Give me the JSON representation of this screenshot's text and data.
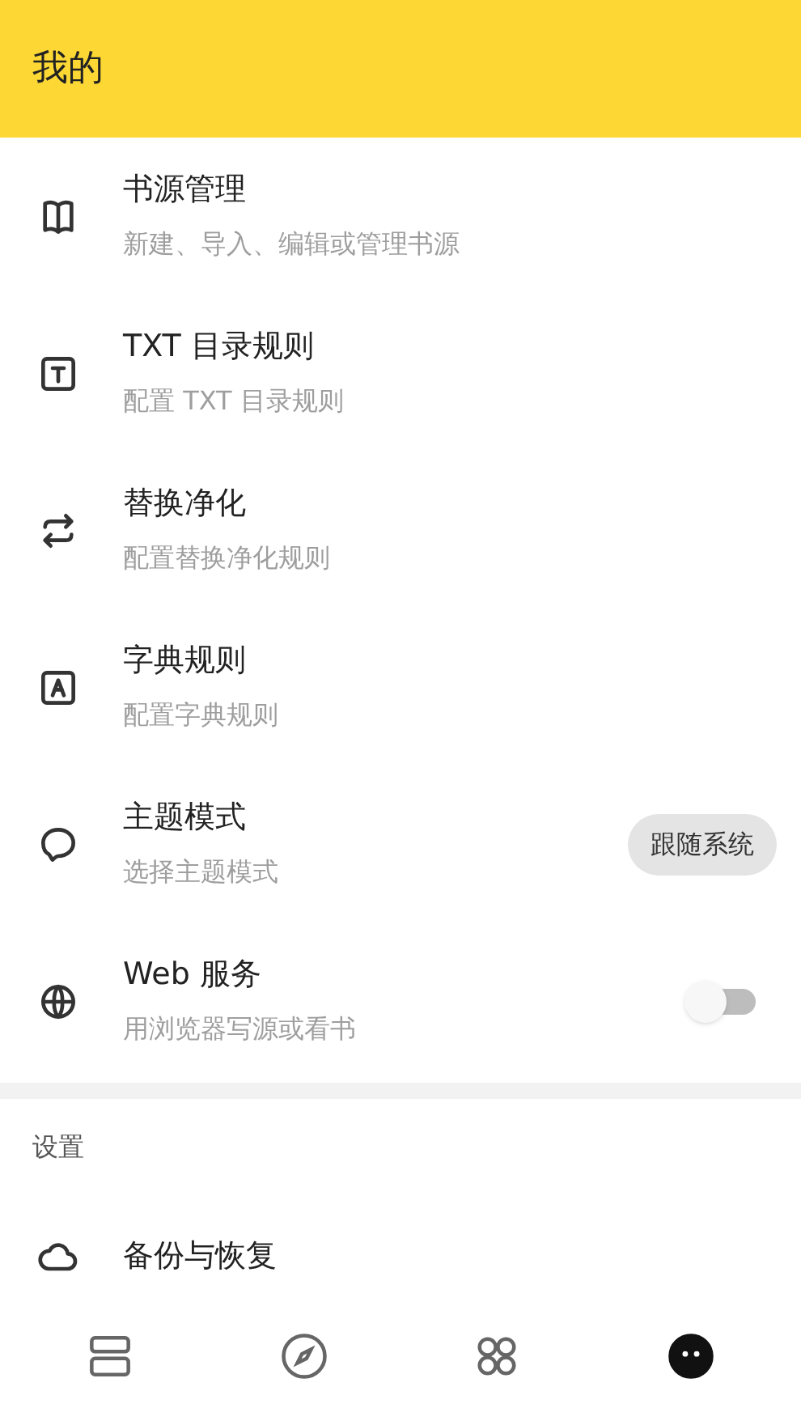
{
  "app_bar": {
    "title": "我的"
  },
  "items": [
    {
      "kind": "plain",
      "title": "书源管理",
      "subtitle": "新建、导入、编辑或管理书源"
    },
    {
      "kind": "plain",
      "title": "TXT 目录规则",
      "subtitle": "配置 TXT 目录规则"
    },
    {
      "kind": "plain",
      "title": "替换净化",
      "subtitle": "配置替换净化规则"
    },
    {
      "kind": "plain",
      "title": "字典规则",
      "subtitle": "配置字典规则"
    },
    {
      "kind": "chip",
      "title": "主题模式",
      "subtitle": "选择主题模式",
      "value": "跟随系统"
    },
    {
      "kind": "switch",
      "title": "Web 服务",
      "subtitle": "用浏览器写源或看书",
      "on": false
    }
  ],
  "section": {
    "header": "设置",
    "items": [
      {
        "title": "备份与恢复"
      }
    ]
  },
  "bottom_nav": [
    {
      "selected": false
    },
    {
      "selected": false
    },
    {
      "selected": false
    },
    {
      "selected": true
    }
  ]
}
